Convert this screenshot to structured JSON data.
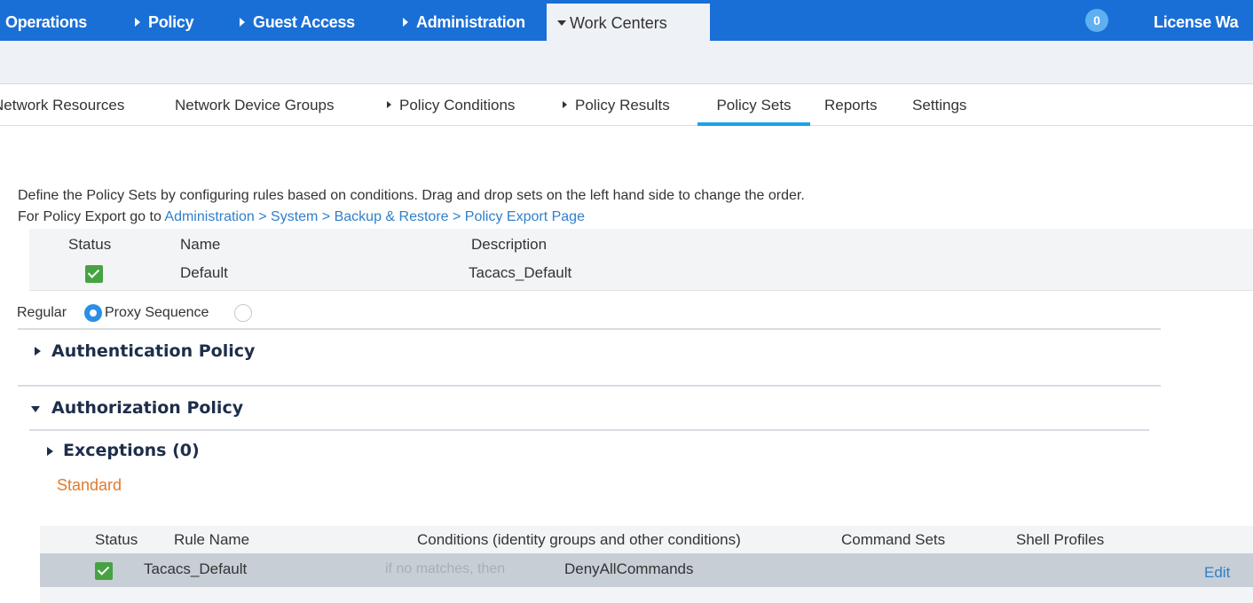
{
  "topnav": {
    "items": [
      "Operations",
      "Policy",
      "Guest Access",
      "Administration"
    ],
    "active": "Work Centers",
    "badge_count": "0",
    "license": "License Wa",
    "bg_color": "#1a6fd6"
  },
  "tabs": [
    "Network Resources",
    "Network Device Groups",
    "Policy Conditions",
    "Policy Results",
    "Policy Sets",
    "Reports",
    "Settings"
  ],
  "selected_tab": "Policy Sets",
  "intro": {
    "line1": "Define the Policy Sets by configuring rules based on conditions. Drag and drop sets on the left hand side to change the order.",
    "line2_prefix": "For Policy Export go to ",
    "line2_link": "Administration > System > Backup & Restore > Policy Export Page"
  },
  "policy_set_table": {
    "headers": [
      "Status",
      "Name",
      "Description"
    ],
    "row": {
      "status": "enabled",
      "name": "Default",
      "description": "Tacacs_Default"
    }
  },
  "mode": {
    "regular_label": "Regular",
    "proxy_label": "Proxy Sequence",
    "selected": "Regular"
  },
  "sections": {
    "authentication": "Authentication Policy",
    "authorization": "Authorization Policy",
    "exceptions": "Exceptions (0)",
    "standard": "Standard"
  },
  "rules_table": {
    "headers": [
      "Status",
      "Rule Name",
      "Conditions (identity groups and other conditions)",
      "Command Sets",
      "Shell Profiles"
    ],
    "row": {
      "status": "enabled",
      "rule_name": "Tacacs_Default",
      "condition": "if no matches, then",
      "command_set": "DenyAllCommands",
      "action": "Edit"
    }
  },
  "colors": {
    "accent": "#1aa3e8",
    "status_green": "#47a341",
    "standard_orange": "#e07b2d",
    "link": "#2f7fcb"
  }
}
